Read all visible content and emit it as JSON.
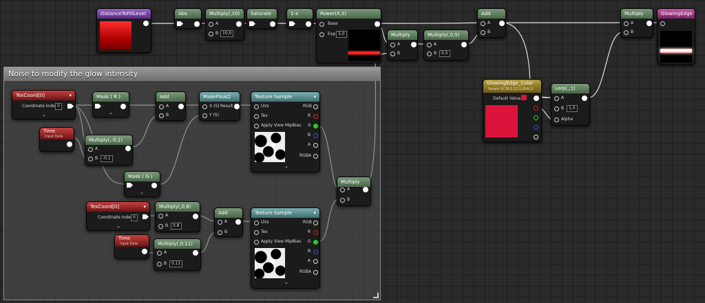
{
  "comment": {
    "title": "Noise to modify the glow intensity"
  },
  "nodes": {
    "distance": {
      "title": "DistanceToFillLevel"
    },
    "abs": {
      "title": "Abs"
    },
    "multiply10": {
      "title": "Multiply(,10)",
      "a": "A",
      "b": "B",
      "b_value": "10,0"
    },
    "saturate": {
      "title": "Saturate"
    },
    "oneminus": {
      "title": "1-x"
    },
    "power": {
      "title": "Power(X,3)",
      "base": "Base",
      "exp": "Exp",
      "exp_value": "3,0"
    },
    "multiply_mid": {
      "title": "Multiply",
      "a": "A",
      "b": "B"
    },
    "multiply05": {
      "title": "Multiply(,0,5)",
      "a": "A",
      "b": "B",
      "b_value": "0,5"
    },
    "add_top": {
      "title": "Add",
      "a": "A",
      "b": "B"
    },
    "multiply_top": {
      "title": "Multiply",
      "a": "A",
      "b": "B"
    },
    "glowing_edge": {
      "title": "GlowingEdge"
    },
    "glow_color": {
      "title": "GlowingEdge_Color",
      "subtitle": "Param (0,78,0,22,0,004,1)",
      "default_label": "Default Value"
    },
    "lerp": {
      "title": "Lerp(,,1)",
      "a": "A",
      "b": "B",
      "b_value": "1,0",
      "alpha": "Alpha"
    },
    "texcoord1": {
      "title": "TexCoord[0]",
      "coord_label": "Coordinate Index",
      "coord_value": "0"
    },
    "mask_rg": {
      "title": "Mask ( R )"
    },
    "add_n1": {
      "title": "Add",
      "a": "A",
      "b": "B"
    },
    "makefloat2": {
      "title": "MakeFloat2",
      "x": "X (S)",
      "y": "Y (S)",
      "result": "Result"
    },
    "texsample1": {
      "title": "Texture Sample",
      "uvs": "UVs",
      "tex": "Tex",
      "mip": "Apply View MipBias",
      "rgb": "RGB",
      "r": "R",
      "g": "G",
      "b": "B",
      "a": "A",
      "rgba": "RGBA"
    },
    "time1": {
      "title": "Time",
      "subtitle": "Input Data"
    },
    "multiply_m01": {
      "title": "Multiply(,-0,1)",
      "a": "A",
      "b": "B",
      "b_value": "-0,1"
    },
    "mask_g": {
      "title": "Mask ( G )"
    },
    "multiply_n": {
      "title": "Multiply",
      "a": "A",
      "b": "B"
    },
    "texcoord2": {
      "title": "TexCoord[0]",
      "coord_label": "Coordinate Index",
      "coord_value": "0"
    },
    "multiply08": {
      "title": "Multiply(,0,8)",
      "a": "A",
      "b": "B",
      "b_value": "0,8"
    },
    "add_n2": {
      "title": "Add",
      "a": "A",
      "b": "B"
    },
    "texsample2": {
      "title": "Texture Sample",
      "uvs": "UVs",
      "tex": "Tex",
      "mip": "Apply View MipBias",
      "rgb": "RGB",
      "r": "R",
      "g": "G",
      "b": "B",
      "a": "A",
      "rgba": "RGBA"
    },
    "time2": {
      "title": "Time",
      "subtitle": "Input Data"
    },
    "multiply011": {
      "title": "Multiply(,0,11)",
      "a": "A",
      "b": "B",
      "b_value": "0,11"
    }
  },
  "icons": {
    "expand": "chevron-down-icon",
    "exec": "output-pin-icon"
  },
  "colors": {
    "glow_color": "#dc143c",
    "wire": "#e0e0e0",
    "channel_r": "#e02020",
    "channel_g": "#20d020",
    "channel_b": "#3050ff"
  }
}
